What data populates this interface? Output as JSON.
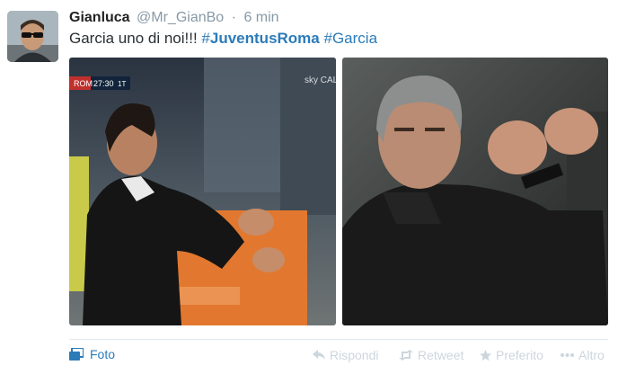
{
  "tweet": {
    "author_name": "Gianluca",
    "author_handle": "@Mr_GianBo",
    "separator": "·",
    "time": "6 min",
    "text_plain": "Garcia uno di noi!!! ",
    "hashtag1_symbol": "#",
    "hashtag1_text": "JuventusRoma",
    "hashtag2": "#Garcia"
  },
  "media": {
    "scoreboard_team": "ROM",
    "scoreboard_time": "27:30",
    "scoreboard_period": "1T",
    "broadcaster": "sky CALC"
  },
  "footer": {
    "foto_label": "Foto",
    "reply_label": "Rispondi",
    "retweet_label": "Retweet",
    "favorite_label": "Preferito",
    "more_label": "Altro"
  },
  "colors": {
    "link": "#2b7bb9",
    "muted": "#8899a6",
    "action_muted": "#ccd6dd"
  }
}
